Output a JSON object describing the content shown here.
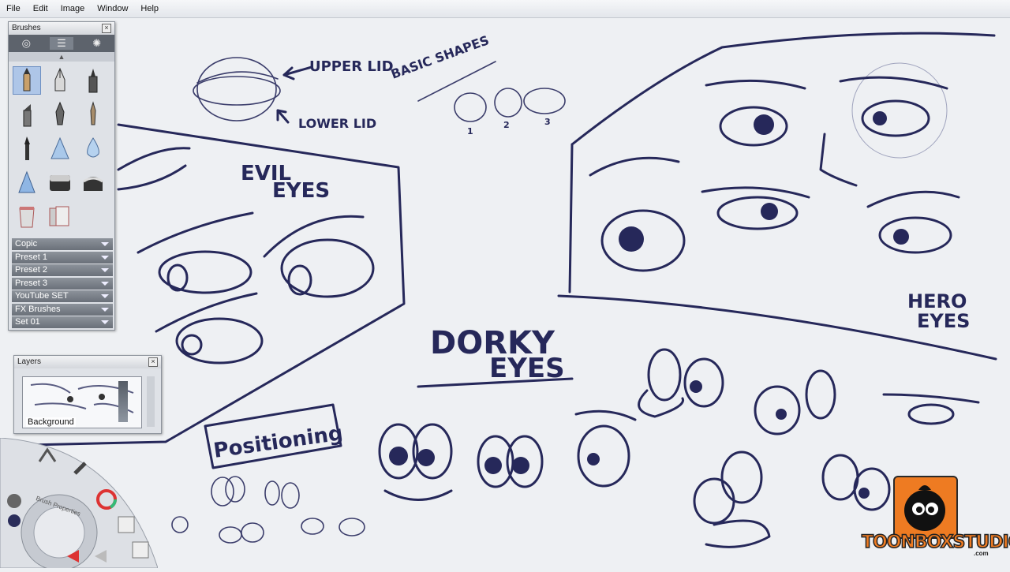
{
  "menu": [
    "File",
    "Edit",
    "Image",
    "Window",
    "Help"
  ],
  "brushes_panel": {
    "title": "Brushes",
    "tab_icons": [
      "brush-icon",
      "sliders-icon",
      "texture-icon"
    ],
    "tools": [
      "pencil",
      "ink-pen",
      "marker",
      "chisel-marker",
      "fountain-pen",
      "fine-brush",
      "paint-brush",
      "airbrush",
      "water-drop",
      "cone",
      "gradient",
      "smudge",
      "bucket",
      "copy-layers"
    ],
    "selected_tool": "pencil",
    "presets": [
      "Copic",
      "Preset 1",
      "Preset 2",
      "Preset 3",
      "YouTube SET",
      "FX Brushes",
      "Set 01"
    ]
  },
  "layers_panel": {
    "title": "Layers",
    "layer_name": "Background"
  },
  "lagoon": {
    "label": "Brush Properties"
  },
  "sketch_labels": {
    "upper_lid": "UPPER LID",
    "lower_lid": "LOWER LID",
    "basic_shapes": "BASIC SHAPES",
    "shape_numbers": [
      "1",
      "2",
      "3"
    ],
    "evil_eyes_1": "EVIL",
    "evil_eyes_2": "EYES",
    "dorky_1": "DORKY",
    "dorky_2": "EYES",
    "hero_1": "HERO",
    "hero_2": "EYES",
    "positioning": "Positioning"
  },
  "logo": {
    "text": "TOONBOXSTUDIO",
    "suffix": ".com",
    "brand_color": "#ee7b22"
  },
  "colors": {
    "ink": "#26285a",
    "canvas": "#eef0f3"
  }
}
